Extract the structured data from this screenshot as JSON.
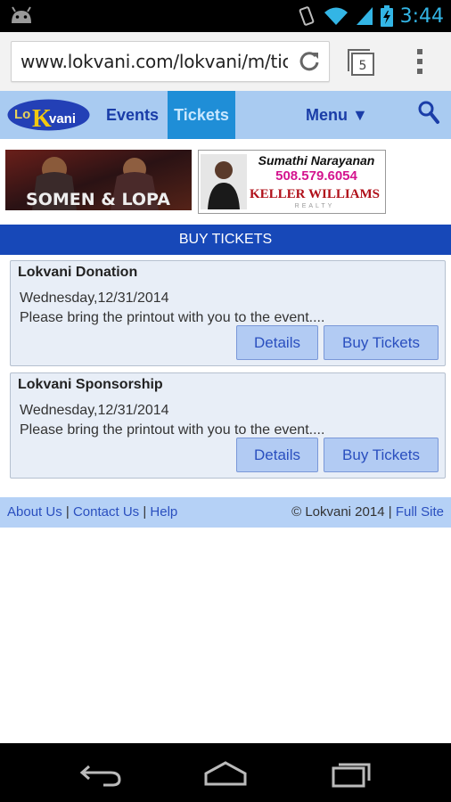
{
  "status_bar": {
    "time": "3:44",
    "icons": [
      "android-icon",
      "vibrate-icon",
      "wifi-icon",
      "signal-icon",
      "battery-icon"
    ]
  },
  "browser": {
    "url": "www.lokvani.com/lokvani/m/tic",
    "tab_count": "5",
    "icons": [
      "reload-icon",
      "tabs-icon",
      "overflow-menu-icon"
    ]
  },
  "site_nav": {
    "logo_text": [
      "Lo",
      "K",
      "vani"
    ],
    "items": [
      {
        "label": "Events"
      },
      {
        "label": "Tickets"
      },
      {
        "label": "Menu ▼"
      }
    ],
    "search_icon": "search-icon",
    "active_color": "#1f8ed7",
    "bar_color": "#a9cbf1"
  },
  "ads": {
    "ad1": {
      "text": "SOMEN & LOPA"
    },
    "ad2": {
      "name": "Sumathi Narayanan",
      "phone": "508.579.6054",
      "company": "KELLER WILLIAMS",
      "sub": "REALTY"
    }
  },
  "section_title": "BUY TICKETS",
  "events": [
    {
      "title": "Lokvani Donation",
      "date": "Wednesday,12/31/2014",
      "description": "Please bring the printout with you to the event....",
      "details_label": "Details",
      "buy_label": "Buy Tickets"
    },
    {
      "title": "Lokvani Sponsorship",
      "date": "Wednesday,12/31/2014",
      "description": "Please bring the printout with you to the event....",
      "details_label": "Details",
      "buy_label": "Buy Tickets"
    }
  ],
  "footer": {
    "about": "About Us",
    "contact": "Contact Us",
    "help": "Help",
    "copyright": "© Lokvani 2014",
    "full_site": "Full Site"
  },
  "system_nav": [
    "back-icon",
    "home-icon",
    "recents-icon"
  ]
}
